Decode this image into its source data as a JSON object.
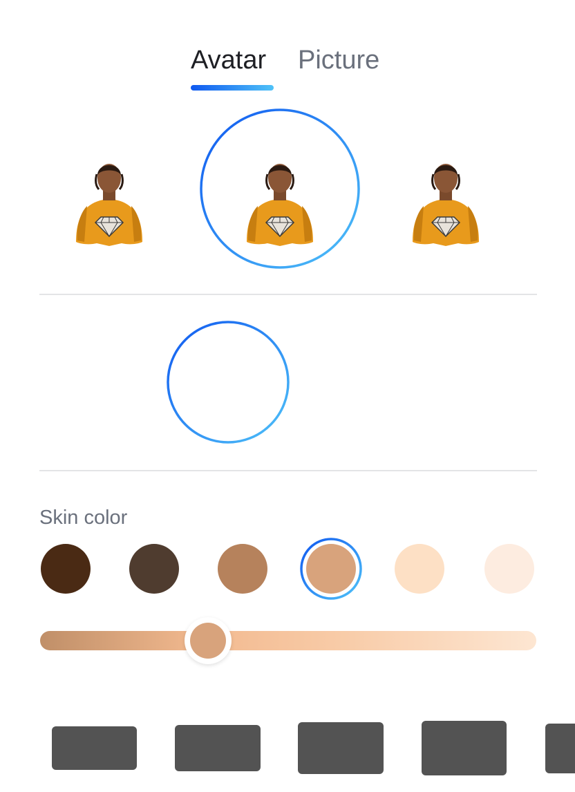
{
  "tabs": {
    "avatar": "Avatar",
    "picture": "Picture",
    "active": "Avatar"
  },
  "avatars": {
    "options": [
      {
        "icon": "avatar-orange-shirt-icon",
        "selected": false
      },
      {
        "icon": "avatar-orange-shirt-icon",
        "selected": true
      },
      {
        "icon": "avatar-orange-shirt-icon",
        "selected": false
      }
    ]
  },
  "skin": {
    "label": "Skin color",
    "swatches": [
      {
        "color": "#4a2a14",
        "selected": false
      },
      {
        "color": "#4f3c2f",
        "selected": false
      },
      {
        "color": "#b6825c",
        "selected": false
      },
      {
        "color": "#d8a37c",
        "selected": true
      },
      {
        "color": "#fde0c5",
        "selected": false
      },
      {
        "color": "#fdece0",
        "selected": false
      }
    ],
    "slider": {
      "value": 0.34,
      "thumb_color": "#d8a37c"
    }
  },
  "colors": {
    "accent_start": "#1059f0",
    "accent_end": "#4fc2f8",
    "tab_active": "#1e1f24",
    "tab_inactive": "#6a707c",
    "tile": "#535353"
  }
}
